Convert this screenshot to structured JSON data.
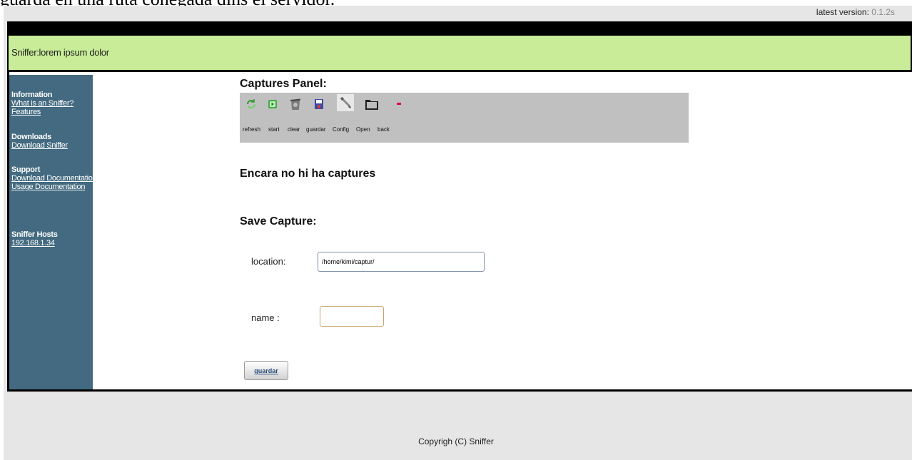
{
  "top_text": "guarda en una ruta conegada dins el servidor.",
  "version": {
    "label": "latest version:",
    "number": "0.1.2s"
  },
  "header": {
    "title": "Sniffer:lorem ipsum dolor"
  },
  "sidebar": {
    "information": {
      "heading": "Information",
      "links": [
        "What is an Sniffer?",
        "Features"
      ]
    },
    "downloads": {
      "heading": "Downloads",
      "links": [
        "Download Sniffer"
      ]
    },
    "support": {
      "heading": "Support",
      "links": [
        "Download Documentation",
        "Usage Documentation"
      ]
    },
    "hosts": {
      "heading": "Sniffer Hosts",
      "links": [
        "192.168.1.34"
      ]
    }
  },
  "panel": {
    "title": "Captures Panel:",
    "tools": [
      {
        "label": "refresh",
        "icon": "refresh-icon"
      },
      {
        "label": "start",
        "icon": "play-icon"
      },
      {
        "label": "clear",
        "icon": "trash-icon"
      },
      {
        "label": "guardar",
        "icon": "floppy-icon"
      },
      {
        "label": "Config",
        "icon": "wrench-icon"
      },
      {
        "label": "Open",
        "icon": "folder-icon"
      },
      {
        "label": "back",
        "icon": "minus-icon"
      }
    ]
  },
  "message": "Encara no hi ha captures",
  "save": {
    "title": "Save Capture:",
    "location_label": "location:",
    "location_value": "/home/kimi/captur/",
    "name_label": "name :",
    "name_value": "",
    "button": "guardar"
  },
  "footer": "Copyrigh (C) Sniffer",
  "colors": {
    "header_bg": "#c8ec98",
    "sidebar_bg": "#436a80",
    "toolbar_bg": "#c0c0c0",
    "page_bg": "#e6e6e6"
  }
}
